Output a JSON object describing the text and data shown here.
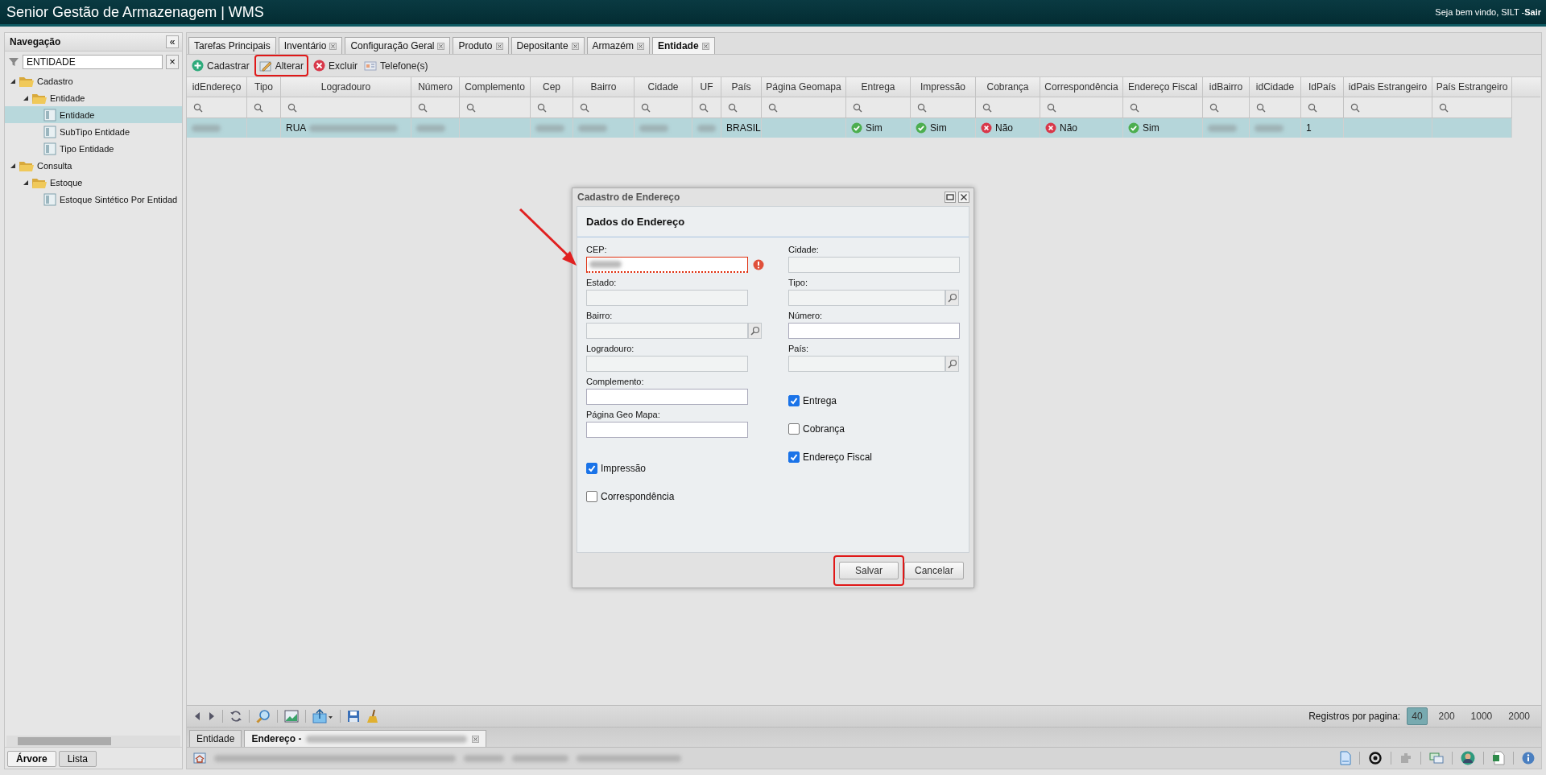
{
  "header": {
    "title": "Senior Gestão de Armazenagem | WMS",
    "welcome": "Seja bem vindo, SILT - ",
    "logout": "Sair"
  },
  "sidebar": {
    "title": "Navegação",
    "collapse": "«",
    "filter": {
      "value": "ENTIDADE",
      "clear": "×"
    },
    "tree": [
      {
        "label": "Cadastro",
        "expanded": true,
        "selected": false,
        "children": [
          {
            "label": "Entidade",
            "expanded": true,
            "selected": false,
            "children": [
              {
                "label": "Entidade",
                "selected": true
              },
              {
                "label": "SubTipo Entidade",
                "selected": false
              },
              {
                "label": "Tipo Entidade",
                "selected": false
              }
            ]
          }
        ]
      },
      {
        "label": "Consulta",
        "expanded": true,
        "selected": false,
        "children": [
          {
            "label": "Estoque",
            "expanded": true,
            "selected": false,
            "children": [
              {
                "label": "Estoque Sintético Por Entidad",
                "selected": false
              }
            ]
          }
        ]
      }
    ],
    "view_tabs": [
      {
        "label": "Árvore",
        "selected": true
      },
      {
        "label": "Lista",
        "selected": false
      }
    ]
  },
  "tabs": [
    {
      "label": "Tarefas Principais",
      "closable": false,
      "selected": false
    },
    {
      "label": "Inventário",
      "closable": true,
      "selected": false
    },
    {
      "label": "Configuração Geral",
      "closable": true,
      "selected": false
    },
    {
      "label": "Produto",
      "closable": true,
      "selected": false
    },
    {
      "label": "Depositante",
      "closable": true,
      "selected": false
    },
    {
      "label": "Armazém",
      "closable": true,
      "selected": false
    },
    {
      "label": "Entidade",
      "closable": true,
      "selected": true
    }
  ],
  "toolbar": [
    {
      "label": "Cadastrar",
      "kind": "add",
      "highlighted": false
    },
    {
      "label": "Alterar",
      "kind": "edit",
      "highlighted": true
    },
    {
      "label": "Excluir",
      "kind": "delete",
      "highlighted": false
    },
    {
      "label": "Telefone(s)",
      "kind": "phone",
      "highlighted": false
    }
  ],
  "table": {
    "columns": [
      "idEndereço",
      "Tipo",
      "Logradouro",
      "Número",
      "Complemento",
      "Cep",
      "Bairro",
      "Cidade",
      "UF",
      "País",
      "Página Geomapa",
      "Entrega",
      "Impressão",
      "Cobrança",
      "Correspondência",
      "Endereço Fiscal",
      "idBairro",
      "idCidade",
      "IdPaís",
      "idPais Estrangeiro",
      "País Estrangeiro"
    ],
    "rows": [
      {
        "selected": true,
        "cells": [
          {
            "kind": "blurred"
          },
          {
            "kind": "empty"
          },
          {
            "kind": "partial",
            "text": "RUA"
          },
          {
            "kind": "blurred"
          },
          {
            "kind": "empty"
          },
          {
            "kind": "blurred"
          },
          {
            "kind": "blurred"
          },
          {
            "kind": "blurred"
          },
          {
            "kind": "blurred"
          },
          {
            "kind": "text",
            "text": "BRASIL"
          },
          {
            "kind": "empty"
          },
          {
            "kind": "flag",
            "ok": true,
            "text": "Sim"
          },
          {
            "kind": "flag",
            "ok": true,
            "text": "Sim"
          },
          {
            "kind": "flag",
            "ok": false,
            "text": "Não"
          },
          {
            "kind": "flag",
            "ok": false,
            "text": "Não"
          },
          {
            "kind": "flag",
            "ok": true,
            "text": "Sim"
          },
          {
            "kind": "blurred"
          },
          {
            "kind": "blurred"
          },
          {
            "kind": "text",
            "text": "1"
          },
          {
            "kind": "empty"
          },
          {
            "kind": "empty"
          }
        ]
      }
    ]
  },
  "dialog": {
    "title": "Cadastro de Endereço",
    "section": "Dados do Endereço",
    "left_fields": [
      {
        "label": "CEP:",
        "kind": "text",
        "readonly": false,
        "error": true
      },
      {
        "label": "Estado:",
        "kind": "text",
        "readonly": true,
        "error": false
      },
      {
        "label": "Bairro:",
        "kind": "lookup",
        "readonly": true,
        "error": false
      },
      {
        "label": "Logradouro:",
        "kind": "text",
        "readonly": true,
        "error": false
      },
      {
        "label": "Complemento:",
        "kind": "text",
        "readonly": false,
        "error": false
      },
      {
        "label": "Página Geo Mapa:",
        "kind": "text",
        "readonly": false,
        "error": false
      }
    ],
    "left_checks": [
      {
        "label": "Impressão",
        "checked": true
      },
      {
        "label": "Correspondência",
        "checked": false
      }
    ],
    "right_fields": [
      {
        "label": "Cidade:",
        "kind": "text",
        "readonly": true,
        "error": false
      },
      {
        "label": "Tipo:",
        "kind": "lookup",
        "readonly": true,
        "error": false
      },
      {
        "label": "Número:",
        "kind": "text",
        "readonly": false,
        "error": false
      },
      {
        "label": "País:",
        "kind": "lookup",
        "readonly": true,
        "error": false
      }
    ],
    "right_checks": [
      {
        "label": "Entrega",
        "checked": true
      },
      {
        "label": "Cobrança",
        "checked": false
      },
      {
        "label": "Endereço Fiscal",
        "checked": true
      }
    ],
    "buttons": [
      {
        "label": "Salvar",
        "highlighted": true
      },
      {
        "label": "Cancelar",
        "highlighted": false
      }
    ]
  },
  "pager": {
    "label": "Registros por pagina:",
    "sizes": [
      {
        "label": "40",
        "selected": true
      },
      {
        "label": "200",
        "selected": false
      },
      {
        "label": "1000",
        "selected": false
      },
      {
        "label": "2000",
        "selected": false
      }
    ]
  },
  "bottom_tabs": [
    {
      "label": "Entidade",
      "selected": false,
      "closable": false
    },
    {
      "label": "Endereço -",
      "selected": true,
      "closable": true
    }
  ]
}
